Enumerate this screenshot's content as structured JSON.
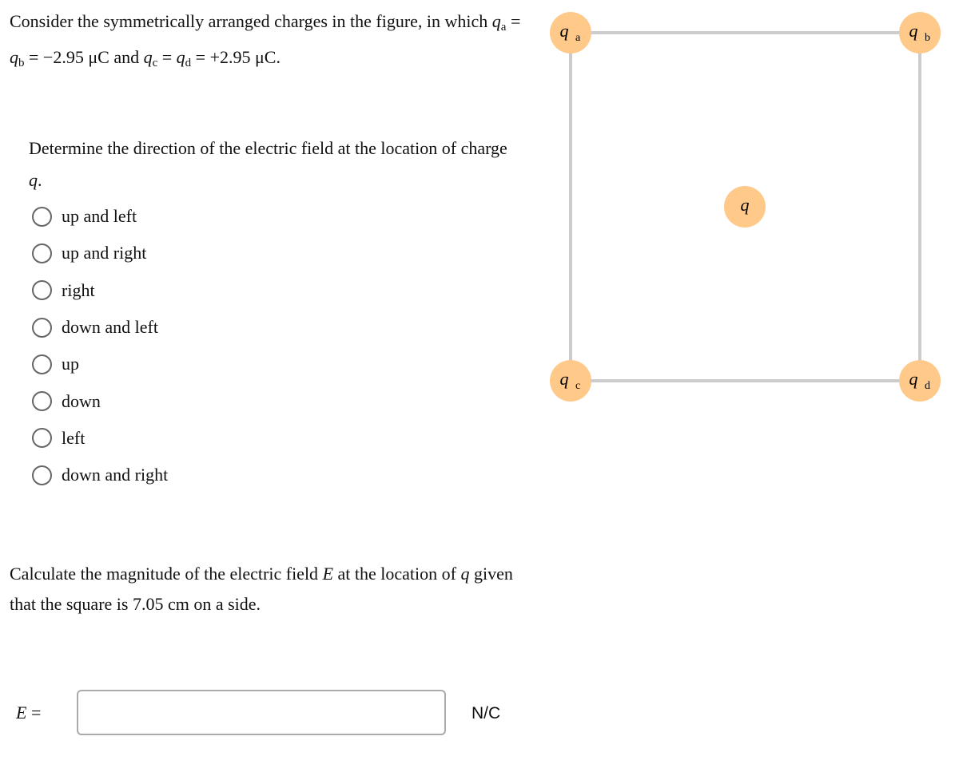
{
  "intro": {
    "prefix": "Consider the symmetrically arranged charges in the figure, in which ",
    "qa_sub": "a",
    "qb_sub": "b",
    "value_ab": "−2.95 μC",
    "and": " and ",
    "qc_sub": "c",
    "qd_sub": "d",
    "value_cd": "+2.95 μC",
    "eq": " = ",
    "q": "q"
  },
  "question1": {
    "text": "Determine the direction of the electric field at the location of charge ",
    "var": "q",
    "end": ".",
    "options": [
      "up and left",
      "up and right",
      "right",
      "down and left",
      "up",
      "down",
      "left",
      "down and right"
    ]
  },
  "question2": {
    "text1": "Calculate the magnitude of the electric field ",
    "var": "E",
    "text2": " at the location of ",
    "var2": "q",
    "text3": " given that the square is 7.05 cm on a side."
  },
  "answer": {
    "label_var": "E",
    "label_eq": " =",
    "value": "",
    "unit": "N/C"
  },
  "figure": {
    "charges": [
      {
        "sym": "q",
        "sub": "a"
      },
      {
        "sym": "q",
        "sub": "b"
      },
      {
        "sym": "q",
        "sub": "c"
      },
      {
        "sym": "q",
        "sub": "d"
      },
      {
        "sym": "q",
        "sub": ""
      }
    ],
    "charge_color": "#ffc98a",
    "line_color": "#cccccc"
  }
}
